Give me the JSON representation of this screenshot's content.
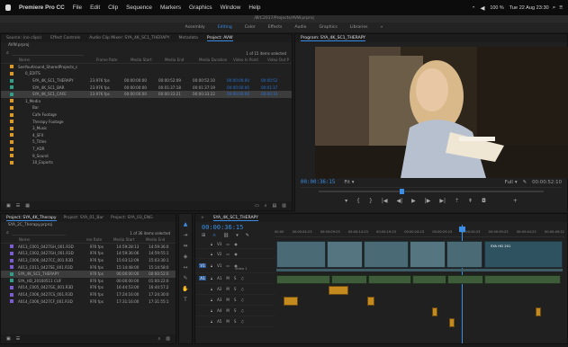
{
  "menubar": {
    "apple": "",
    "app": "Premiere Pro CC",
    "items": [
      "File",
      "Edit",
      "Clip",
      "Sequence",
      "Markers",
      "Graphics",
      "Window",
      "Help"
    ],
    "status": "100 %",
    "clock": "Tue 22 Aug 23:30"
  },
  "path": "/Ø/C2017/Projects/AVW.prproj",
  "workspaces": [
    "Assembly",
    "Editing",
    "Color",
    "Effects",
    "Audio",
    "Graphics",
    "Libraries",
    "»"
  ],
  "project": {
    "tabs": [
      "Source: (no clips)",
      "Effect Controls",
      "Audio Clip Mixer: SYA_4K_SC1_THERAPY",
      "Metadata",
      "Project: AVW"
    ],
    "file": "AVW.prproj",
    "count": "1 of 15 items selected",
    "columns": [
      "Name",
      "Frame Rate",
      "Media Start",
      "Media End",
      "Media Duration",
      "Video In Point",
      "Video Out P"
    ],
    "rows": [
      {
        "name": "SeeYouAround_SharedProjects_c",
        "fr": "",
        "ms": "",
        "me": "",
        "md": "",
        "vi": "",
        "vo": "",
        "color": "#e09a1a"
      },
      {
        "name": "0_EDITS",
        "fr": "",
        "ms": "",
        "me": "",
        "md": "",
        "vi": "",
        "vo": "",
        "color": "#e09a1a"
      },
      {
        "name": "SYA_4K_SC1_THERAPY",
        "fr": "23.976 fps",
        "ms": "00:00:00:00",
        "me": "00:00:52:09",
        "md": "00:00:52:10",
        "vi": "00:00:00:00",
        "vo": "00:00:52",
        "color": "#2ea08a"
      },
      {
        "name": "SYA_4K_SC1_BAR",
        "fr": "23.976 fps",
        "ms": "00:00:00:00",
        "me": "00:01:37:18",
        "md": "00:01:37:19",
        "vi": "00:00:00:00",
        "vo": "00:01:37",
        "color": "#2ea08a"
      },
      {
        "name": "SYA_4K_SC1_CAFE",
        "fr": "23.976 fps",
        "ms": "00:00:00:00",
        "me": "00:00:33:21",
        "md": "00:00:33:22",
        "vi": "00:00:00:00",
        "vo": "00:00:33",
        "color": "#2ea08a"
      },
      {
        "name": "1_Media",
        "fr": "",
        "ms": "",
        "me": "",
        "md": "",
        "vi": "",
        "vo": "",
        "color": "#e09a1a"
      },
      {
        "name": "Bar",
        "fr": "",
        "ms": "",
        "me": "",
        "md": "",
        "vi": "",
        "vo": "",
        "color": "#e09a1a"
      },
      {
        "name": "Cafe Footage",
        "fr": "",
        "ms": "",
        "me": "",
        "md": "",
        "vi": "",
        "vo": "",
        "color": "#e09a1a"
      },
      {
        "name": "Therapy Footage",
        "fr": "",
        "ms": "",
        "me": "",
        "md": "",
        "vi": "",
        "vo": "",
        "color": "#e09a1a"
      },
      {
        "name": "3_Music",
        "fr": "",
        "ms": "",
        "me": "",
        "md": "",
        "vi": "",
        "vo": "",
        "color": "#e09a1a"
      },
      {
        "name": "4_SFX",
        "fr": "",
        "ms": "",
        "me": "",
        "md": "",
        "vi": "",
        "vo": "",
        "color": "#e09a1a"
      },
      {
        "name": "5_Titles",
        "fr": "",
        "ms": "",
        "me": "",
        "md": "",
        "vi": "",
        "vo": "",
        "color": "#e09a1a"
      },
      {
        "name": "7_ADR",
        "fr": "",
        "ms": "",
        "me": "",
        "md": "",
        "vi": "",
        "vo": "",
        "color": "#e09a1a"
      },
      {
        "name": "9_Sound",
        "fr": "",
        "ms": "",
        "me": "",
        "md": "",
        "vi": "",
        "vo": "",
        "color": "#e09a1a"
      },
      {
        "name": "10_Exports",
        "fr": "",
        "ms": "",
        "me": "",
        "md": "",
        "vi": "",
        "vo": "",
        "color": "#e09a1a"
      }
    ]
  },
  "program": {
    "title": "Program: SYA_4K_SC1_THERAPY",
    "timecode": "00:00:36:15",
    "fit": "Fit",
    "quality": "Full",
    "duration": "00:00:52:10"
  },
  "bin": {
    "tabs": [
      "Project: SYA_4K_Therapy",
      "Project: SYA_01_Bar",
      "Project: SYA_03_ENG"
    ],
    "file": "SYA_2C_Therapy.prproj",
    "count": "1 of 36 items selected",
    "columns": [
      "Name",
      "me Rate",
      "Media Start",
      "Media End"
    ],
    "rows": [
      {
        "name": "A013_C001_0427GH_001.R3D",
        "fr": "976 fps",
        "ms": "14:59:28:13",
        "me": "14:59:36:0",
        "color": "#7b5bd6"
      },
      {
        "name": "A013_C002_0427GH_001.R3D",
        "fr": "976 fps",
        "ms": "14:59:36:06",
        "me": "14:59:55:1",
        "color": "#7b5bd6"
      },
      {
        "name": "A013_C006_0427CC_001.R3D",
        "fr": "976 fps",
        "ms": "15:03:12:09",
        "me": "15:03:30:1",
        "color": "#7b5bd6"
      },
      {
        "name": "A013_C011_0427SE_001.R3D",
        "fr": "976 fps",
        "ms": "15:14:48:00",
        "me": "15:14:58:0",
        "color": "#7b5bd6"
      },
      {
        "name": "SYA_4K_SC1_THERAPY",
        "fr": "976 fps",
        "ms": "00:00:00:00",
        "me": "00:00:52:0",
        "color": "#2ea08a"
      },
      {
        "name": "SYA_HD_20160511 CUF",
        "fr": "976 fps",
        "ms": "00:00:00:00",
        "me": "01:00:22:0",
        "color": "#2ea08a"
      },
      {
        "name": "A014_C005_0427GE_001.R3D",
        "fr": "976 fps",
        "ms": "16:44:53:00",
        "me": "16:44:57:2",
        "color": "#7b5bd6"
      },
      {
        "name": "A014_C006_0427CS_001.R3D",
        "fr": "976 fps",
        "ms": "17:24:16:00",
        "me": "17:24:30:0",
        "color": "#7b5bd6"
      },
      {
        "name": "A014_C006_0427CF_001.R3D",
        "fr": "976 fps",
        "ms": "17:31:16:00",
        "me": "17:31:55:1",
        "color": "#7b5bd6"
      }
    ]
  },
  "timeline": {
    "tab": "SYA_4K_SC1_THERAPY",
    "timecode": "00:00:36:15",
    "ruler": [
      "00:00",
      "00:00:04:23",
      "00:00:09:23",
      "00:00:14:23",
      "00:00:19:23",
      "00:00:24:23",
      "00:00:29:23",
      "00:00:34:23",
      "00:00:39:23",
      "00:00:44:22",
      "00:00:49:22"
    ],
    "vtracks": [
      "V3",
      "V2",
      "V1"
    ],
    "atracks": [
      "A1",
      "A2",
      "A3",
      "A4",
      "A5"
    ],
    "v1label": "Video 1",
    "clip_hd": "SYA HD 201"
  },
  "colors": {
    "accent": "#3a8ee6",
    "folder": "#e09a1a",
    "sequence": "#2ea08a",
    "clip": "#7b5bd6"
  }
}
